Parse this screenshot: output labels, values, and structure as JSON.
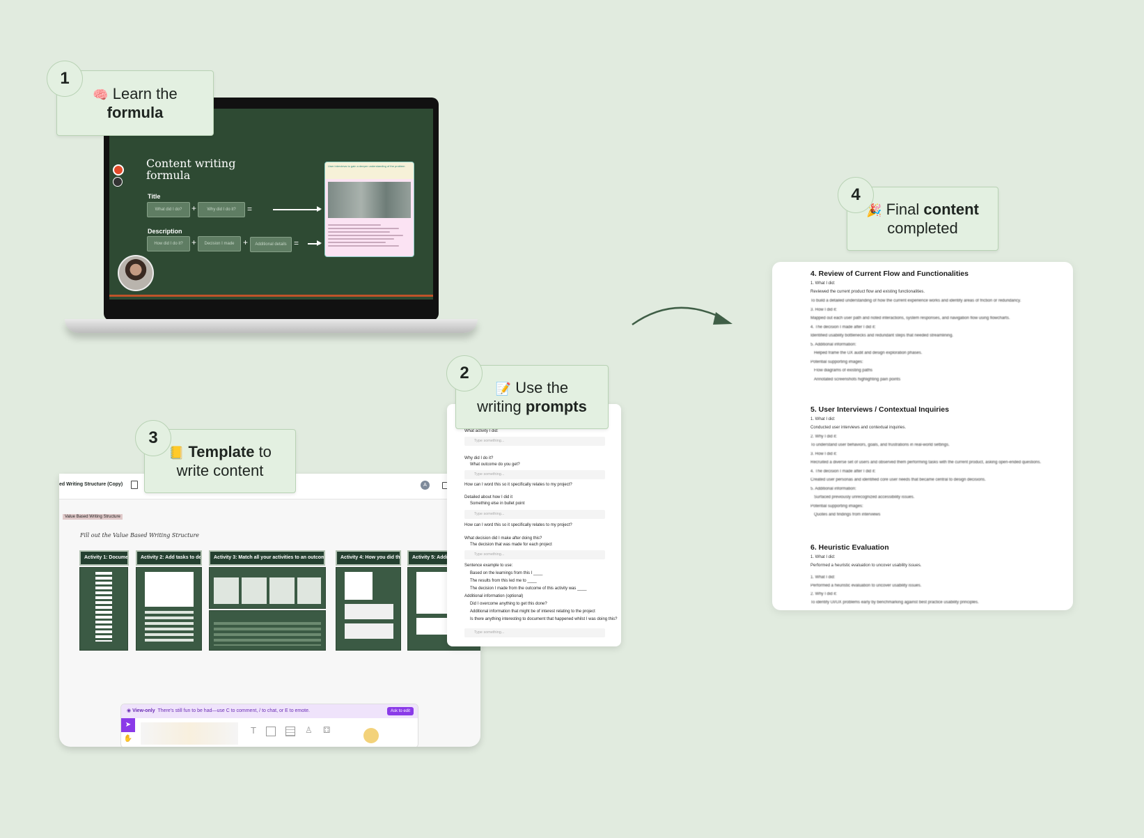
{
  "steps": [
    {
      "number": "1",
      "emoji": "🧠",
      "line1": "Learn the",
      "bold": "formula"
    },
    {
      "number": "2",
      "emoji": "📝",
      "line1": "Use the",
      "line2": "writing",
      "bold": "prompts"
    },
    {
      "number": "3",
      "emoji": "📒",
      "bold": "Template",
      "line1": "to",
      "line2": "write content"
    },
    {
      "number": "4",
      "emoji": "🎉",
      "line1": "Final",
      "bold": "content",
      "line2": "completed"
    }
  ],
  "slide": {
    "title": "Content writing formula",
    "title_label": "Title",
    "title_pills": [
      "What did I do?",
      "Why did I do it?"
    ],
    "description_label": "Description",
    "description_pills": [
      "How did I do it?",
      "Decision I made",
      "Additional details"
    ],
    "plus": "+",
    "equals": "=",
    "card_heading": "User interviews to gain a deeper understanding of the problem"
  },
  "template": {
    "doc_title": "ed Writing Structure (Copy)",
    "tag": "Value Based Writing Structure",
    "heading": "Fill out the Value Based Writing Structure",
    "activities": [
      "Activity 1: Document...",
      "Activity 2: Add tasks to desig...",
      "Activity 3: Match all your activities to an outcome",
      "Activity 4: How you did the ac...",
      "Activity 5: Additiona"
    ],
    "view_only": "View-only",
    "view_hint": "There's still fun to be had—use C to comment, / to chat, or E to emote.",
    "ask_button": "Ask to edit",
    "avatar": "A"
  },
  "prompts": {
    "lines": [
      "What activity I did:",
      "Why did I do it?",
      "What outcome do you get?",
      "How can I word this so it specifically relates to my project?",
      "Detailed about how I did it",
      "Something else in bullet point",
      "How can I word this so it specifically relates to my project?",
      "What decision did I make after doing this?",
      "The decision that was made for each project",
      "Sentence example to use:",
      "Based on the learnings from this I ____",
      "The results from this led me to ____",
      "The decision I made from the outcome of this activity was ____",
      "Additional information (optional)",
      "Did I overcome anything to get this done?",
      "Additional information that might be of interest relating to the project",
      "Is there anything interesting to document that happened whilst I was doing this?"
    ],
    "placeholder": "Type something..."
  },
  "final": {
    "sections": [
      {
        "heading": "4. Review of Current Flow and Functionalities",
        "lines": [
          "1. What I did:",
          "Reviewed the current product flow and existing functionalities."
        ],
        "blurred": [
          "To build a detailed understanding of how the current experience works and identify areas of friction or redundancy.",
          "3. How I did it:",
          "Mapped out each user path and noted interactions, system responses, and navigation flow using flowcharts.",
          "4. The decision I made after I did it:",
          "Identified usability bottlenecks and redundant steps that needed streamlining.",
          "5. Additional information:",
          "Helped frame the UX audit and design exploration phases.",
          "Potential supporting images:",
          "Flow diagrams of existing paths",
          "Annotated screenshots highlighting pain points"
        ]
      },
      {
        "heading": "5. User Interviews / Contextual Inquiries",
        "lines": [
          "1. What I did:",
          "Conducted user interviews and contextual inquiries."
        ],
        "blurred": [
          "2. Why I did it:",
          "To understand user behaviors, goals, and frustrations in real-world settings.",
          "3. How I did it:",
          "Recruited a diverse set of users and observed them performing tasks with the current product, asking open-ended questions.",
          "4. The decision I made after I did it:",
          "Created user personas and identified core user needs that became central to design decisions.",
          "5. Additional information:",
          "Surfaced previously unrecognized accessibility issues.",
          "Potential supporting images:",
          "Quotes and findings from interviews"
        ]
      },
      {
        "heading": "6. Heuristic Evaluation",
        "lines": [
          "1. What I did:",
          "Performed a heuristic evaluation to uncover usability issues."
        ],
        "blurred": [
          "1. What I did:",
          "Performed a heuristic evaluation to uncover usability issues.",
          "2. Why I did it:",
          "To identify UI/UX problems early by benchmarking against best practice usability principles."
        ]
      }
    ]
  },
  "colors": {
    "background": "#e1ebdf",
    "callout": "#e3f0e1",
    "slide": "#2e4a33",
    "accent": "#8a3ae8"
  }
}
